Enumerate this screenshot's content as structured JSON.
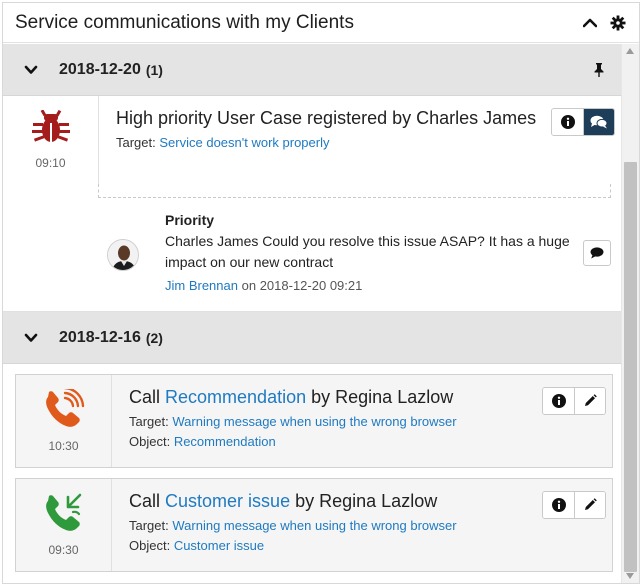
{
  "header": {
    "title": "Service communications with my Clients"
  },
  "groups": [
    {
      "date": "2018-12-20",
      "count": "(1)",
      "items": [
        {
          "icon": "bug-icon",
          "time": "09:10",
          "headline": "High priority User Case registered by Charles James",
          "target_label": "Target:",
          "target_value": "Service doesn't work properly",
          "comment": {
            "subject": "Priority",
            "text": "Charles James Could you resolve this issue ASAP? It has a huge impact on our new contract",
            "author": "Jim Brennan",
            "on_label": "on",
            "datetime": "2018-12-20 09:21"
          }
        }
      ]
    },
    {
      "date": "2018-12-16",
      "count": "(2)",
      "items": [
        {
          "icon": "phone-outgoing-icon",
          "time": "10:30",
          "call_label": "Call",
          "call_link": "Recommendation",
          "by_label": "by",
          "by_name": "Regina Lazlow",
          "target_label": "Target:",
          "target_value": "Warning message when using the wrong browser",
          "object_label": "Object:",
          "object_value": "Recommendation"
        },
        {
          "icon": "phone-incoming-icon",
          "time": "09:30",
          "call_label": "Call",
          "call_link": "Customer issue",
          "by_label": "by",
          "by_name": "Regina Lazlow",
          "target_label": "Target:",
          "target_value": "Warning message when using the wrong browser",
          "object_label": "Object:",
          "object_value": "Customer issue"
        }
      ]
    }
  ],
  "colors": {
    "accent_link": "#1f7ac1",
    "bug_red": "#a51c1c",
    "phone_orange": "#e05a1c",
    "phone_green": "#2f9a3c",
    "active_button": "#1d3d59",
    "group_header_bg": "#e4e4e4"
  }
}
